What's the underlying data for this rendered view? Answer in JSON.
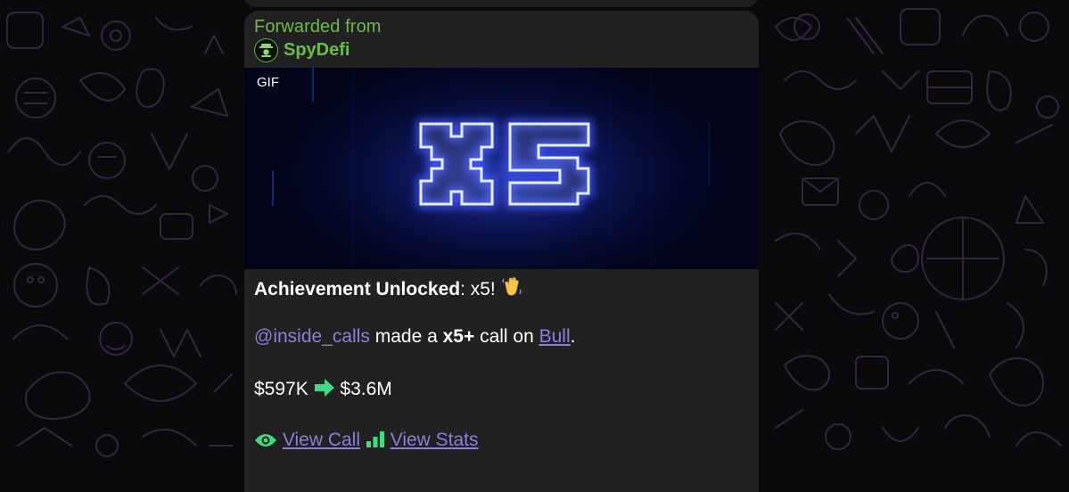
{
  "forward": {
    "label": "Forwarded from",
    "source_name": "SpyDefi"
  },
  "media": {
    "badge": "GIF",
    "overlay_text": "x5"
  },
  "message": {
    "headline_prefix": "Achievement Unlocked",
    "headline_suffix": ": x5!",
    "mention": "@inside_calls",
    "made_text": " made a ",
    "multiplier": "x5+",
    "call_on_text": " call on ",
    "token_link": "Bull",
    "period": ".",
    "from_value": "$597K",
    "to_value": "$3.6M",
    "view_call_label": "View Call",
    "view_stats_label": "View Stats"
  },
  "colors": {
    "forward_green": "#6cbb45",
    "link_purple": "#8a7fdc",
    "bubble_bg": "#212121",
    "neon_blue": "#5a6cff"
  },
  "icons": {
    "headline_emoji": "waving-hand-icon",
    "arrow": "right-arrow-icon",
    "view_call": "eye-icon",
    "view_stats": "bar-chart-icon"
  }
}
